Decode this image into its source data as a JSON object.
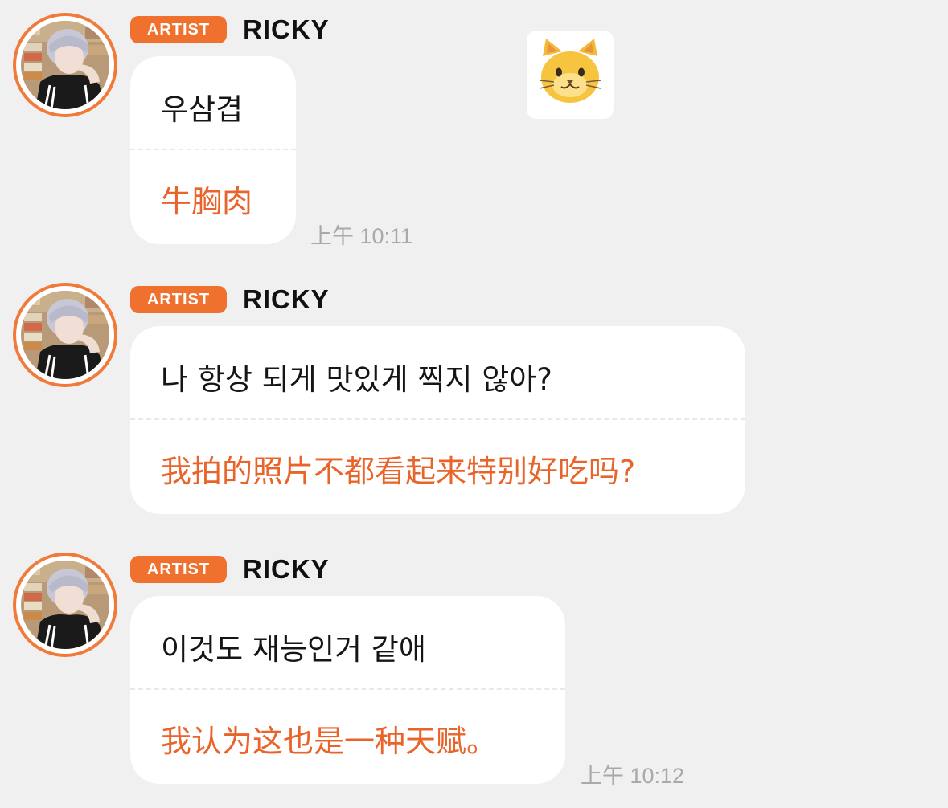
{
  "messages": [
    {
      "badge": "ARTIST",
      "name": "RICKY",
      "korean": "우삼겹",
      "chinese": "牛胸肉",
      "time": "上午 10:11"
    },
    {
      "badge": "ARTIST",
      "name": "RICKY",
      "korean": "나 항상 되게 맛있게 찍지 않아?",
      "chinese": "我拍的照片不都看起来特别好吃吗?",
      "time": ""
    },
    {
      "badge": "ARTIST",
      "name": "RICKY",
      "korean": "이것도 재능인거 같애",
      "chinese": "我认为这也是一种天赋。",
      "time": "上午 10:12"
    }
  ],
  "sticker": {
    "icon": "cat-face-icon"
  },
  "colors": {
    "accent": "#f0702e",
    "translation": "#e8642a",
    "background": "#f0f0f0",
    "bubble": "#ffffff",
    "timestamp": "#a9a9a9"
  }
}
